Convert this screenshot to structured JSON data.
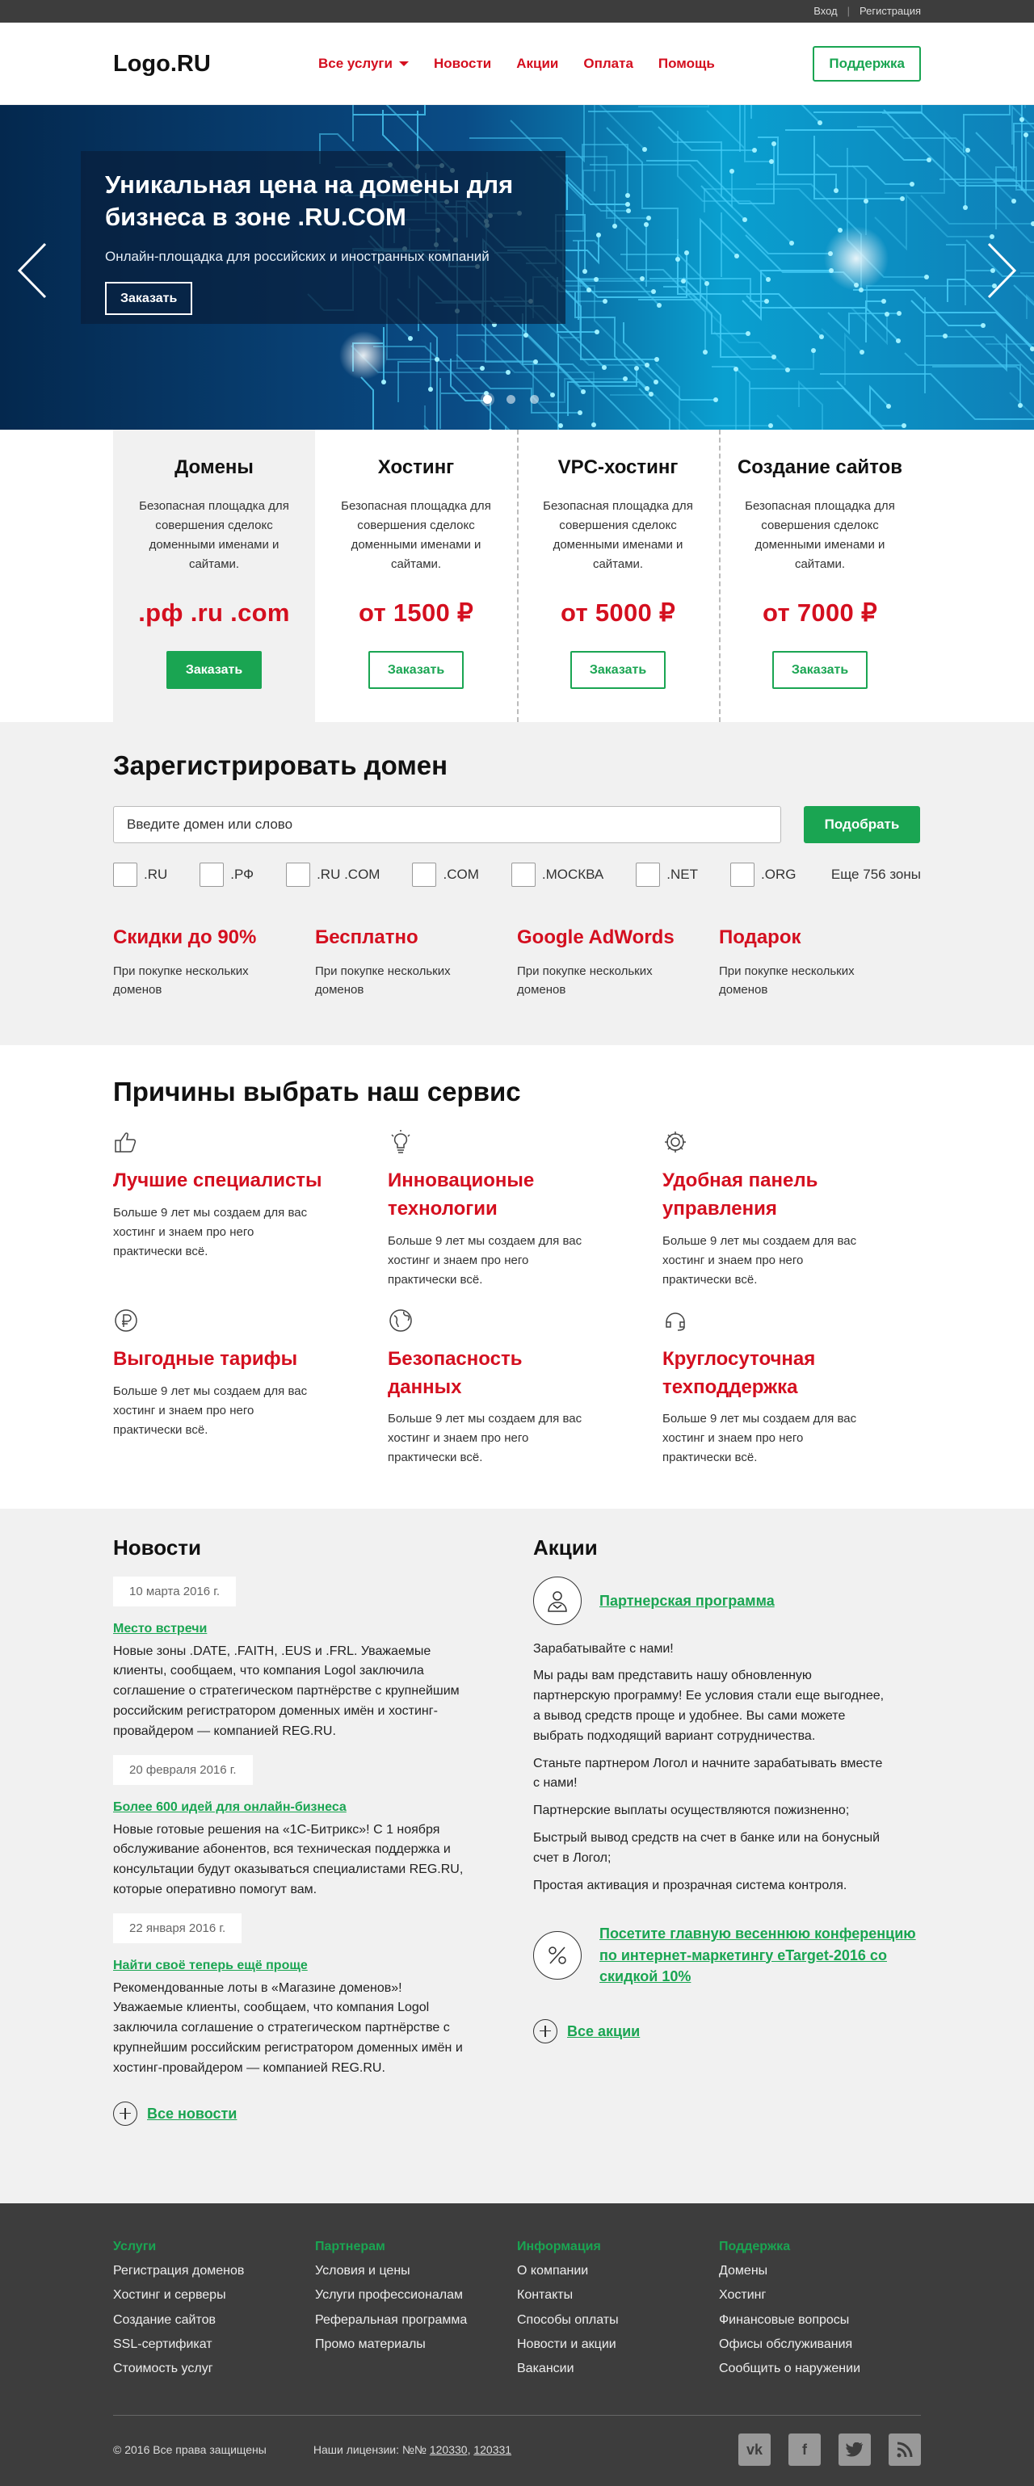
{
  "topbar": {
    "login": "Вход",
    "sep": "|",
    "register": "Регистрация"
  },
  "header": {
    "logo": "Logo.RU",
    "nav": [
      "Все услуги",
      "Новости",
      "Акции",
      "Оплата",
      "Помощь"
    ],
    "support": "Поддержка"
  },
  "hero": {
    "title": "Уникальная цена на домены для бизнеса в зоне .RU.COM",
    "subtitle": "Онлайн-площадка для российских и иностранных компаний",
    "button": "Заказать"
  },
  "services": [
    {
      "title": "Домены",
      "text": "Безопасная площадка для совершения сделокс доменными именами и сайтами.",
      "price": ".рф .ru .com",
      "button": "Заказать"
    },
    {
      "title": "Хостинг",
      "text": "Безопасная площадка для совершения сделокс доменными именами и сайтами.",
      "price": "от 1500 ₽",
      "button": "Заказать"
    },
    {
      "title": "VPC-хостинг",
      "text": "Безопасная площадка для совершения сделокс доменными именами и сайтами.",
      "price": "от 5000 ₽",
      "button": "Заказать"
    },
    {
      "title": "Создание сайтов",
      "text": "Безопасная площадка для совершения сделокс доменными именами и сайтами.",
      "price": "от 7000 ₽",
      "button": "Заказать"
    }
  ],
  "domain": {
    "title": "Зарегистрировать домен",
    "placeholder": "Введите домен или слово",
    "button": "Подобрать",
    "zones": [
      ".RU",
      ".РФ",
      ".RU .COM",
      ".COM",
      ".МОСКВА",
      ".NET",
      ".ORG"
    ],
    "more": "Еще 756 зоны",
    "perks": [
      {
        "title": "Скидки до 90%",
        "text": "При покупке нескольких доменов"
      },
      {
        "title": "Бесплатно",
        "text": "При покупке нескольких доменов"
      },
      {
        "title": "Google AdWords",
        "text": "При покупке нескольких доменов"
      },
      {
        "title": "Подарок",
        "text": "При покупке нескольких доменов"
      }
    ]
  },
  "reasons": {
    "title": "Причины выбрать наш сервис",
    "items": [
      {
        "icon": "thumbs-up-icon",
        "title": "Лучшие специалисты",
        "text": "Больше 9 лет мы создаем для вас хостинг и знаем про него практически всё."
      },
      {
        "icon": "lightbulb-icon",
        "title": "Инновационые технологии",
        "text": "Больше 9 лет мы создаем для вас хостинг и знаем про него практически всё."
      },
      {
        "icon": "gear-icon",
        "title": "Удобная панель управления",
        "text": "Больше 9 лет мы создаем для вас хостинг и знаем про него практически всё."
      },
      {
        "icon": "ruble-icon",
        "title": "Выгодные тарифы",
        "text": "Больше 9 лет мы создаем для вас хостинг и знаем про него практически всё."
      },
      {
        "icon": "shield-globe-icon",
        "title": "Безопасность данных",
        "text": "Больше 9 лет мы создаем для вас хостинг и знаем про него практически всё."
      },
      {
        "icon": "support-icon",
        "title": "Круглосуточная техподдержка",
        "text": "Больше 9 лет мы создаем для вас хостинг и знаем про него практически всё."
      }
    ]
  },
  "news": {
    "title": "Новости",
    "items": [
      {
        "date": "10 марта 2016 г.",
        "title": "Место встречи",
        "text": "Новые зоны .DATE, .FAITH, .EUS и .FRL. Уважаемые клиенты, сообщаем, что компания Logol заключила соглашение о стратегическом партнёрстве с крупнейшим российским регистратором доменных имён и хостинг-провайдером — компанией REG.RU."
      },
      {
        "date": "20 февраля 2016 г.",
        "title": "Более 600 идей для онлайн-бизнеса",
        "text": "Новые готовые решения на «1С-Битрикс»! С 1 ноября обслуживание абонентов, вся техническая поддержка и консультации будут оказываться специалистами REG.RU, которые оперативно помогут вам."
      },
      {
        "date": "22 января 2016 г.",
        "title": "Найти своё теперь ещё проще",
        "text": "Рекомендованные лоты в «Магазине доменов»! Уважаемые клиенты, сообщаем, что компания Logol заключила соглашение о стратегическом партнёрстве с крупнейшим российским регистратором доменных имён и хостинг-провайдером — компанией REG.RU."
      }
    ],
    "all": "Все новости"
  },
  "promos": {
    "title": "Акции",
    "partner_link": "Партнерская программа",
    "paragraphs": [
      "Зарабатывайте с нами!",
      "Мы рады вам представить нашу обновленную партнерскую программу! Ее условия стали еще выгоднее, а вывод средств проще и удобнее. Вы сами можете выбрать подходящий вариант сотрудничества.",
      "Станьте партнером Логол и начните зарабатывать вместе с нами!",
      "Партнерские выплаты осуществляются пожизненно;",
      "Быстрый вывод средств на счет в банке или на бонусный счет в Логол;",
      "Простая активация и прозрачная система контроля."
    ],
    "discount_link": "Посетите главную весеннюю конференцию по интернет-маркетингу eTarget-2016 со скидкой 10%",
    "all": "Все акции"
  },
  "footer": {
    "columns": [
      {
        "title": "Услуги",
        "links": [
          "Регистрация доменов",
          "Хостинг и серверы",
          "Создание сайтов",
          "SSL-сертификат",
          "Стоимость услуг"
        ]
      },
      {
        "title": "Партнерам",
        "links": [
          "Условия и цены",
          "Услуги профессионалам",
          "Реферальная программа",
          "Промо материалы"
        ]
      },
      {
        "title": "Информация",
        "links": [
          "О компании",
          "Контакты",
          "Способы оплаты",
          "Новости и акции",
          "Вакансии"
        ]
      },
      {
        "title": "Поддержка",
        "links": [
          "Домены",
          "Хостинг",
          "Финансовые вопросы",
          "Офисы обслуживания",
          "Сообщить о наружении"
        ]
      }
    ],
    "copyright": "© 2016 Все права защищены",
    "license_label": "Наши лицензии: №№",
    "licenses": [
      "120330",
      "120331"
    ],
    "social": [
      "vk-icon",
      "facebook-icon",
      "twitter-icon",
      "rss-icon"
    ]
  }
}
